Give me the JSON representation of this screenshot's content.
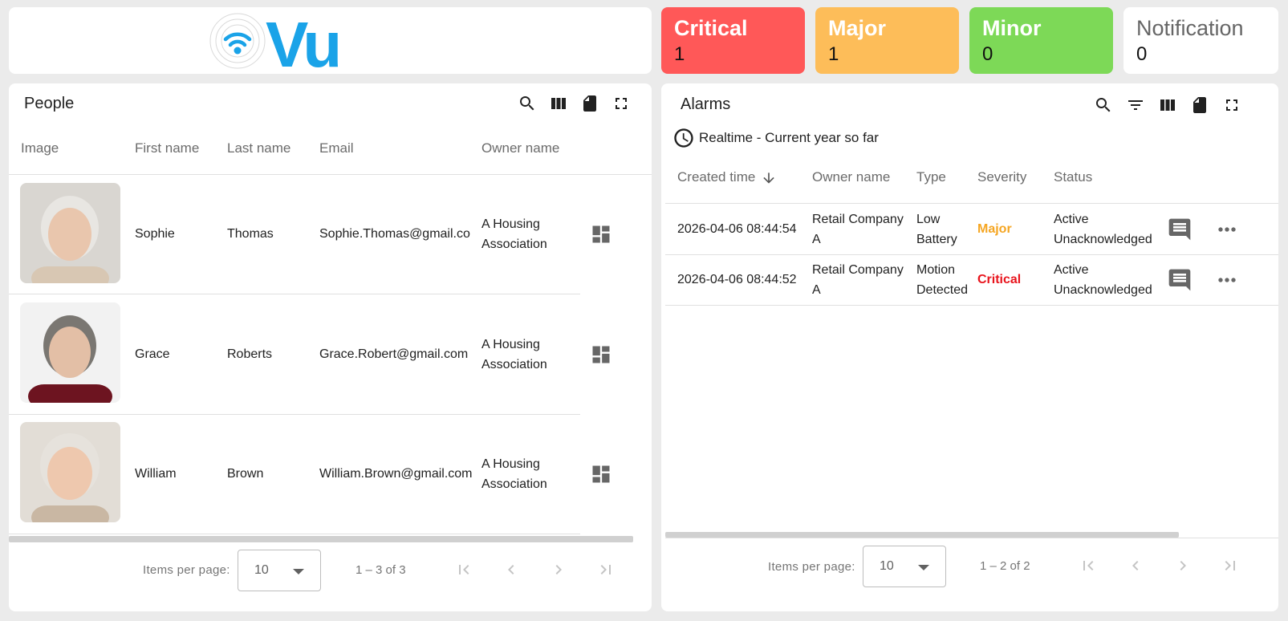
{
  "logo": {
    "text": "Vu",
    "brand_color": "#1aa3e8"
  },
  "severity": {
    "critical": {
      "label": "Critical",
      "count": "1",
      "color": "#ff5858"
    },
    "major": {
      "label": "Major",
      "count": "1",
      "color": "#fdbd59"
    },
    "minor": {
      "label": "Minor",
      "count": "0",
      "color": "#7dd957"
    },
    "notification": {
      "label": "Notification",
      "count": "0",
      "color": "#ffffff"
    }
  },
  "people": {
    "title": "People",
    "tools": [
      "search-icon",
      "columns-icon",
      "export-icon",
      "fullscreen-icon"
    ],
    "columns": [
      "Image",
      "First name",
      "Last name",
      "Email",
      "Owner name"
    ],
    "rows": [
      {
        "first": "Sophie",
        "last": "Thomas",
        "email": "Sophie.Thomas@gmail.co",
        "owner": [
          "A Housing",
          "Association"
        ],
        "shirt": "#d8c7b3",
        "hair": "#e8e6e2"
      },
      {
        "first": "Grace",
        "last": "Roberts",
        "email": "Grace.Robert@gmail.com",
        "owner": [
          "A Housing",
          "Association"
        ],
        "shirt": "#6d1420",
        "hair": "#7a7772"
      },
      {
        "first": "William",
        "last": "Brown",
        "email": "William.Brown@gmail.com",
        "owner": [
          "A Housing",
          "Association"
        ],
        "shirt": "#c9b7a3",
        "hair": "#e6e2dc"
      }
    ],
    "paginator": {
      "items_label": "Items per page:",
      "page_size": "10",
      "range": "1 – 3 of 3"
    }
  },
  "alarms": {
    "title": "Alarms",
    "tools": [
      "search-icon",
      "filter-icon",
      "columns-icon",
      "export-icon",
      "fullscreen-icon"
    ],
    "timewindow": "Realtime - Current year so far",
    "columns": [
      "Created time",
      "Owner name",
      "Type",
      "Severity",
      "Status"
    ],
    "rows": [
      {
        "time": "2026-04-06 08:44:54",
        "owner": [
          "Retail Company",
          "A"
        ],
        "type": [
          "Low",
          "Battery"
        ],
        "severity": "Major",
        "severity_color": "#f5a623",
        "status": [
          "Active",
          "Unacknowledged"
        ]
      },
      {
        "time": "2026-04-06 08:44:52",
        "owner": [
          "Retail Company",
          "A"
        ],
        "type": [
          "Motion",
          "Detected"
        ],
        "severity": "Critical",
        "severity_color": "#e8141c",
        "status": [
          "Active",
          "Unacknowledged"
        ]
      }
    ],
    "paginator": {
      "items_label": "Items per page:",
      "page_size": "10",
      "range": "1 – 2 of 2"
    }
  }
}
